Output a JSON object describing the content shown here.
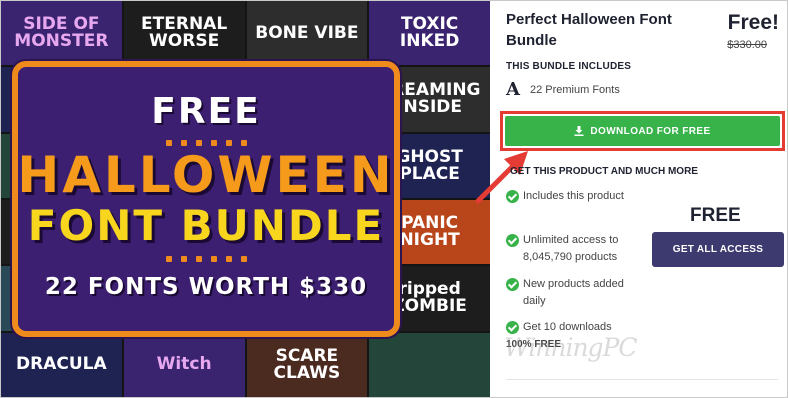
{
  "promo": {
    "tiles": [
      "SIDE OF MONSTER",
      "ETERNAL WORSE",
      "BONE VIBE",
      "TOXIC INKED",
      "",
      "",
      "",
      "CREAMING INSIDE",
      "",
      "",
      "",
      "GHOST PLACE",
      "",
      "",
      "",
      "PANIC NIGHT",
      "",
      "",
      "",
      "ripped ZOMBIE",
      "DRACULA",
      "Witch",
      "SCARE CLAWS",
      ""
    ],
    "badge_free": "FREE",
    "badge_halloween": "HALLOWEEN",
    "badge_font_bundle": "FONT BUNDLE",
    "badge_subtitle": "22 FONTS WORTH $330",
    "colors": {
      "badge_bg": "#3d1f72",
      "badge_border": "#ef8a1d",
      "halloween": "#f59a1b",
      "font_bundle": "#f7d61d"
    }
  },
  "product": {
    "title": "Perfect Halloween Font Bundle",
    "price": "Free!",
    "old_price": "$330.00",
    "includes_heading": "THIS BUNDLE INCLUDES",
    "font_icon": "A",
    "font_count": "22 Premium Fonts",
    "download_label": "DOWNLOAD FOR FREE",
    "get_heading": "GET THIS PRODUCT AND MUCH MORE",
    "features": [
      "Includes this product",
      "Unlimited access to 8,045,790 products",
      "New products added daily",
      "Get 10 downloads"
    ],
    "percent_free": "100% FREE",
    "access_price": "FREE",
    "access_label": "GET ALL ACCESS",
    "watermark": "WinningPC",
    "colors": {
      "download": "#37b34a",
      "highlight": "#e53b35",
      "access": "#3d3a6f"
    },
    "icons": [
      "download-icon",
      "check-icon",
      "arrow-icon"
    ]
  }
}
